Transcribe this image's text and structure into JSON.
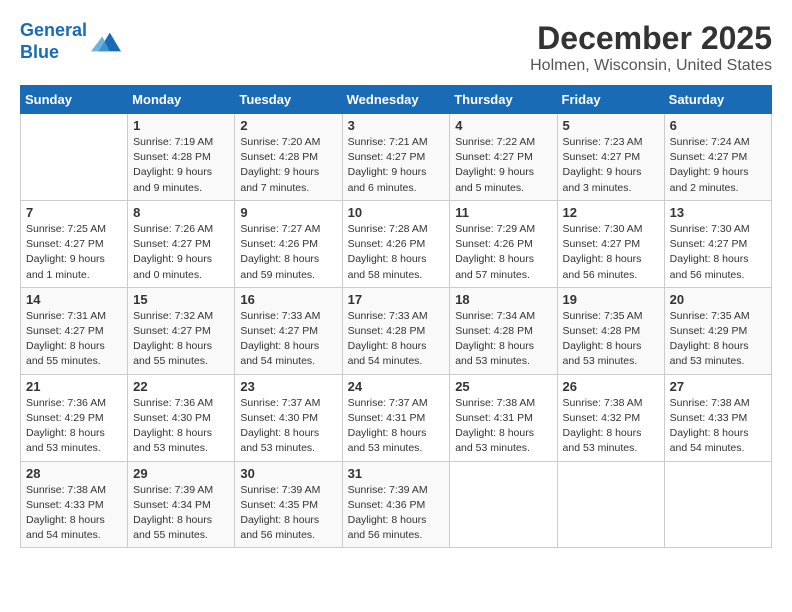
{
  "header": {
    "logo_line1": "General",
    "logo_line2": "Blue",
    "title": "December 2025",
    "subtitle": "Holmen, Wisconsin, United States"
  },
  "days_of_week": [
    "Sunday",
    "Monday",
    "Tuesday",
    "Wednesday",
    "Thursday",
    "Friday",
    "Saturday"
  ],
  "weeks": [
    [
      {
        "day": "",
        "sunrise": "",
        "sunset": "",
        "daylight": ""
      },
      {
        "day": "1",
        "sunrise": "Sunrise: 7:19 AM",
        "sunset": "Sunset: 4:28 PM",
        "daylight": "Daylight: 9 hours and 9 minutes."
      },
      {
        "day": "2",
        "sunrise": "Sunrise: 7:20 AM",
        "sunset": "Sunset: 4:28 PM",
        "daylight": "Daylight: 9 hours and 7 minutes."
      },
      {
        "day": "3",
        "sunrise": "Sunrise: 7:21 AM",
        "sunset": "Sunset: 4:27 PM",
        "daylight": "Daylight: 9 hours and 6 minutes."
      },
      {
        "day": "4",
        "sunrise": "Sunrise: 7:22 AM",
        "sunset": "Sunset: 4:27 PM",
        "daylight": "Daylight: 9 hours and 5 minutes."
      },
      {
        "day": "5",
        "sunrise": "Sunrise: 7:23 AM",
        "sunset": "Sunset: 4:27 PM",
        "daylight": "Daylight: 9 hours and 3 minutes."
      },
      {
        "day": "6",
        "sunrise": "Sunrise: 7:24 AM",
        "sunset": "Sunset: 4:27 PM",
        "daylight": "Daylight: 9 hours and 2 minutes."
      }
    ],
    [
      {
        "day": "7",
        "sunrise": "Sunrise: 7:25 AM",
        "sunset": "Sunset: 4:27 PM",
        "daylight": "Daylight: 9 hours and 1 minute."
      },
      {
        "day": "8",
        "sunrise": "Sunrise: 7:26 AM",
        "sunset": "Sunset: 4:27 PM",
        "daylight": "Daylight: 9 hours and 0 minutes."
      },
      {
        "day": "9",
        "sunrise": "Sunrise: 7:27 AM",
        "sunset": "Sunset: 4:26 PM",
        "daylight": "Daylight: 8 hours and 59 minutes."
      },
      {
        "day": "10",
        "sunrise": "Sunrise: 7:28 AM",
        "sunset": "Sunset: 4:26 PM",
        "daylight": "Daylight: 8 hours and 58 minutes."
      },
      {
        "day": "11",
        "sunrise": "Sunrise: 7:29 AM",
        "sunset": "Sunset: 4:26 PM",
        "daylight": "Daylight: 8 hours and 57 minutes."
      },
      {
        "day": "12",
        "sunrise": "Sunrise: 7:30 AM",
        "sunset": "Sunset: 4:27 PM",
        "daylight": "Daylight: 8 hours and 56 minutes."
      },
      {
        "day": "13",
        "sunrise": "Sunrise: 7:30 AM",
        "sunset": "Sunset: 4:27 PM",
        "daylight": "Daylight: 8 hours and 56 minutes."
      }
    ],
    [
      {
        "day": "14",
        "sunrise": "Sunrise: 7:31 AM",
        "sunset": "Sunset: 4:27 PM",
        "daylight": "Daylight: 8 hours and 55 minutes."
      },
      {
        "day": "15",
        "sunrise": "Sunrise: 7:32 AM",
        "sunset": "Sunset: 4:27 PM",
        "daylight": "Daylight: 8 hours and 55 minutes."
      },
      {
        "day": "16",
        "sunrise": "Sunrise: 7:33 AM",
        "sunset": "Sunset: 4:27 PM",
        "daylight": "Daylight: 8 hours and 54 minutes."
      },
      {
        "day": "17",
        "sunrise": "Sunrise: 7:33 AM",
        "sunset": "Sunset: 4:28 PM",
        "daylight": "Daylight: 8 hours and 54 minutes."
      },
      {
        "day": "18",
        "sunrise": "Sunrise: 7:34 AM",
        "sunset": "Sunset: 4:28 PM",
        "daylight": "Daylight: 8 hours and 53 minutes."
      },
      {
        "day": "19",
        "sunrise": "Sunrise: 7:35 AM",
        "sunset": "Sunset: 4:28 PM",
        "daylight": "Daylight: 8 hours and 53 minutes."
      },
      {
        "day": "20",
        "sunrise": "Sunrise: 7:35 AM",
        "sunset": "Sunset: 4:29 PM",
        "daylight": "Daylight: 8 hours and 53 minutes."
      }
    ],
    [
      {
        "day": "21",
        "sunrise": "Sunrise: 7:36 AM",
        "sunset": "Sunset: 4:29 PM",
        "daylight": "Daylight: 8 hours and 53 minutes."
      },
      {
        "day": "22",
        "sunrise": "Sunrise: 7:36 AM",
        "sunset": "Sunset: 4:30 PM",
        "daylight": "Daylight: 8 hours and 53 minutes."
      },
      {
        "day": "23",
        "sunrise": "Sunrise: 7:37 AM",
        "sunset": "Sunset: 4:30 PM",
        "daylight": "Daylight: 8 hours and 53 minutes."
      },
      {
        "day": "24",
        "sunrise": "Sunrise: 7:37 AM",
        "sunset": "Sunset: 4:31 PM",
        "daylight": "Daylight: 8 hours and 53 minutes."
      },
      {
        "day": "25",
        "sunrise": "Sunrise: 7:38 AM",
        "sunset": "Sunset: 4:31 PM",
        "daylight": "Daylight: 8 hours and 53 minutes."
      },
      {
        "day": "26",
        "sunrise": "Sunrise: 7:38 AM",
        "sunset": "Sunset: 4:32 PM",
        "daylight": "Daylight: 8 hours and 53 minutes."
      },
      {
        "day": "27",
        "sunrise": "Sunrise: 7:38 AM",
        "sunset": "Sunset: 4:33 PM",
        "daylight": "Daylight: 8 hours and 54 minutes."
      }
    ],
    [
      {
        "day": "28",
        "sunrise": "Sunrise: 7:38 AM",
        "sunset": "Sunset: 4:33 PM",
        "daylight": "Daylight: 8 hours and 54 minutes."
      },
      {
        "day": "29",
        "sunrise": "Sunrise: 7:39 AM",
        "sunset": "Sunset: 4:34 PM",
        "daylight": "Daylight: 8 hours and 55 minutes."
      },
      {
        "day": "30",
        "sunrise": "Sunrise: 7:39 AM",
        "sunset": "Sunset: 4:35 PM",
        "daylight": "Daylight: 8 hours and 56 minutes."
      },
      {
        "day": "31",
        "sunrise": "Sunrise: 7:39 AM",
        "sunset": "Sunset: 4:36 PM",
        "daylight": "Daylight: 8 hours and 56 minutes."
      },
      {
        "day": "",
        "sunrise": "",
        "sunset": "",
        "daylight": ""
      },
      {
        "day": "",
        "sunrise": "",
        "sunset": "",
        "daylight": ""
      },
      {
        "day": "",
        "sunrise": "",
        "sunset": "",
        "daylight": ""
      }
    ]
  ]
}
